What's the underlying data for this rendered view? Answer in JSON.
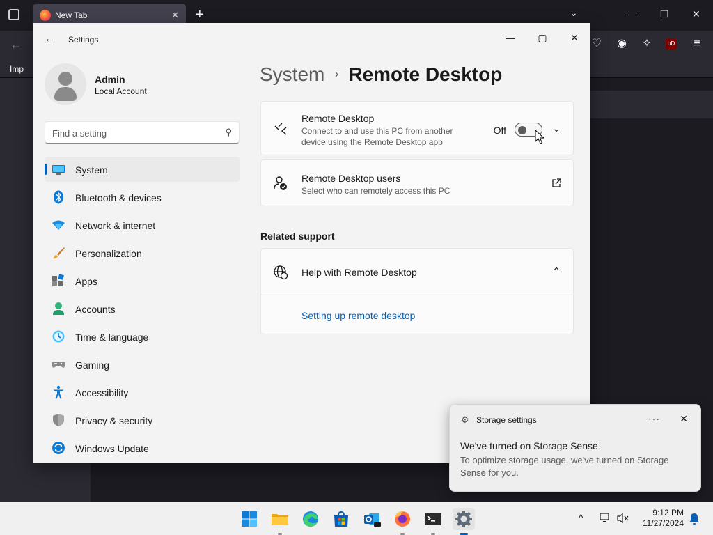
{
  "firefox": {
    "tab_title": "New Tab",
    "tab_close": "✕",
    "new_tab": "+",
    "all_tabs": "⌄",
    "bookmark_label": "Imp"
  },
  "settings": {
    "window_title": "Settings",
    "user": {
      "name": "Admin",
      "account_type": "Local Account"
    },
    "search": {
      "placeholder": "Find a setting"
    },
    "nav": [
      {
        "label": "System",
        "icon": "system-icon",
        "active": true
      },
      {
        "label": "Bluetooth & devices",
        "icon": "bluetooth-icon"
      },
      {
        "label": "Network & internet",
        "icon": "wifi-icon"
      },
      {
        "label": "Personalization",
        "icon": "brush-icon"
      },
      {
        "label": "Apps",
        "icon": "apps-icon"
      },
      {
        "label": "Accounts",
        "icon": "accounts-icon"
      },
      {
        "label": "Time & language",
        "icon": "time-language-icon"
      },
      {
        "label": "Gaming",
        "icon": "gamepad-icon"
      },
      {
        "label": "Accessibility",
        "icon": "accessibility-icon"
      },
      {
        "label": "Privacy & security",
        "icon": "shield-icon"
      },
      {
        "label": "Windows Update",
        "icon": "windows-update-icon"
      }
    ],
    "breadcrumb": {
      "parent": "System",
      "separator": "›",
      "current": "Remote Desktop"
    },
    "remote_desktop_card": {
      "title": "Remote Desktop",
      "description": "Connect to and use this PC from another device using the Remote Desktop app",
      "toggle_label": "Off",
      "toggle_on": false
    },
    "users_card": {
      "title": "Remote Desktop users",
      "description": "Select who can remotely access this PC"
    },
    "related_support": {
      "heading": "Related support",
      "help_title": "Help with Remote Desktop",
      "link": "Setting up remote desktop"
    }
  },
  "toast": {
    "app_name": "Storage settings",
    "more": "···",
    "close": "✕",
    "heading": "We've turned on Storage Sense",
    "body": "To optimize storage usage, we've turned on Storage Sense for you."
  },
  "taskbar": {
    "apps": [
      "start",
      "file-explorer",
      "edge",
      "microsoft-store",
      "outlook",
      "firefox",
      "terminal",
      "settings"
    ],
    "active_app": "settings",
    "tray_chevron": "^",
    "clock_time": "9:12 PM",
    "clock_date": "11/27/2024"
  },
  "colors": {
    "accent": "#005fb8",
    "window_bg": "#f3f3f3",
    "card_bg": "#fbfbfb",
    "firefox_dark": "#1c1b22"
  }
}
